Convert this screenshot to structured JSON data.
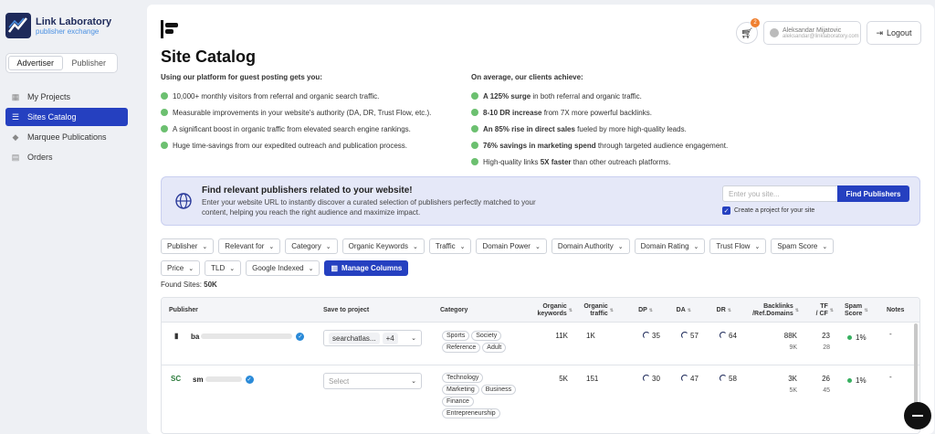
{
  "app": {
    "logo_title": "Link Laboratory",
    "logo_subtitle": "publisher exchange"
  },
  "mode_tabs": [
    {
      "label": "Advertiser",
      "active": true
    },
    {
      "label": "Publisher",
      "active": false
    }
  ],
  "nav": [
    {
      "label": "My Projects",
      "icon": "grid-icon",
      "active": false
    },
    {
      "label": "Sites Catalog",
      "icon": "list-icon",
      "active": true
    },
    {
      "label": "Marquee Publications",
      "icon": "gem-icon",
      "active": false
    },
    {
      "label": "Orders",
      "icon": "cart-icon",
      "active": false
    }
  ],
  "header": {
    "cart_count": "2",
    "user_name": "Aleksandar Mijatovic",
    "user_email": "aleksandar@linklaboratory.com",
    "logout_label": "Logout"
  },
  "page_title": "Site Catalog",
  "benefits_left": {
    "heading": "Using our platform for guest posting gets you:",
    "items": [
      "10,000+ monthly visitors from referral and organic search traffic.",
      "Measurable improvements in your website's authority (DA, DR, Trust Flow, etc.).",
      "A significant boost in organic traffic from elevated search engine rankings.",
      "Huge time-savings from our expedited outreach and publication process."
    ]
  },
  "benefits_right": {
    "heading": "On average, our clients achieve:",
    "items": [
      {
        "bold": "A 125% surge",
        "rest": " in both referral and organic traffic."
      },
      {
        "bold": "8-10 DR increase",
        "rest": " from 7X more powerful backlinks."
      },
      {
        "bold": "An 85% rise in direct sales",
        "rest": " fueled by more high-quality leads."
      },
      {
        "bold": "76% savings in marketing spend",
        "rest": " through targeted audience engagement."
      },
      {
        "pre": "High-quality links ",
        "bold": "5X faster",
        "rest": " than other outreach platforms."
      }
    ]
  },
  "banner": {
    "title": "Find relevant publishers related to your website!",
    "description": "Enter your website URL to instantly discover a curated selection of publishers perfectly matched to your content, helping you reach the right audience and maximize impact.",
    "input_placeholder": "Enter you site...",
    "button_label": "Find Publishers",
    "checkbox_label": "Create a project for your site",
    "checkbox_checked": true
  },
  "filters_row1": [
    "Publisher",
    "Relevant for",
    "Category",
    "Organic Keywords",
    "Traffic",
    "Domain Power",
    "Domain Authority",
    "Domain Rating",
    "Trust Flow",
    "Spam Score"
  ],
  "filters_row2": [
    "Price",
    "TLD",
    "Google Indexed"
  ],
  "manage_columns_label": "Manage Columns",
  "found_sites": {
    "label": "Found Sites:",
    "value": "50K"
  },
  "table": {
    "headers": {
      "publisher": "Publisher",
      "save": "Save to project",
      "category": "Category",
      "keywords_1": "Organic",
      "keywords_2": "keywords",
      "traffic_1": "Organic",
      "traffic_2": "traffic",
      "dp": "DP",
      "da": "DA",
      "dr": "DR",
      "backlinks_1": "Backlinks",
      "backlinks_2": "/Ref.Domains",
      "tf_1": "TF",
      "tf_2": "/ CF",
      "spam_1": "Spam",
      "spam_2": "Score",
      "notes": "Notes"
    },
    "rows": [
      {
        "publisher": "ba",
        "fav": "▮",
        "save_value": "searchatlas...",
        "save_extra": "+4",
        "categories": [
          "Sports",
          "Society",
          "Reference",
          "Adult"
        ],
        "keywords": "11K",
        "traffic": "1K",
        "dp": "35",
        "da": "57",
        "dr": "64",
        "backlinks": "88K",
        "ref_domains": "9K",
        "tf": "23",
        "cf": "28",
        "spam": "1%",
        "notes": "-"
      },
      {
        "publisher": "sm",
        "fav": "SC",
        "save_placeholder": "Select",
        "categories": [
          "Technology",
          "Marketing",
          "Business",
          "Finance",
          "Entrepreneurship"
        ],
        "keywords": "5K",
        "traffic": "151",
        "dp": "30",
        "da": "47",
        "dr": "58",
        "backlinks": "3K",
        "ref_domains": "5K",
        "tf": "26",
        "cf": "45",
        "spam": "1%",
        "notes": "-"
      }
    ]
  }
}
